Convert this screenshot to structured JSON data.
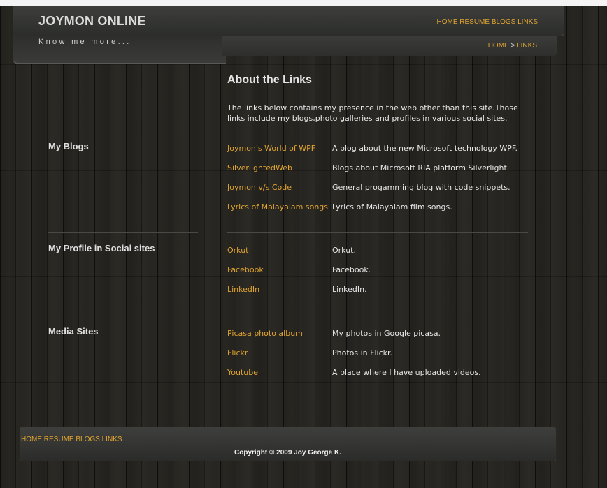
{
  "header": {
    "title": "JOYMON ONLINE",
    "tagline": "Know me more...",
    "nav": [
      "HOME",
      "RESUME",
      "BLOGS",
      "LINKS"
    ],
    "breadcrumb": {
      "home": "HOME",
      "separator": " > ",
      "current": "LINKS"
    }
  },
  "main": {
    "heading": "About the Links",
    "intro": "The links below contains my presence in the web other than this site.Those links include my blogs,photo galleries and profiles in various social sites.",
    "sections": [
      {
        "title": "My Blogs",
        "links": [
          {
            "label": "Joymon's World of WPF",
            "desc": "A blog about the new Microsoft technology WPF."
          },
          {
            "label": "SilverlightedWeb",
            "desc": "Blogs about Microsoft RIA platform Silverlight."
          },
          {
            "label": "Joymon v/s Code",
            "desc": "General progamming blog with code snippets."
          },
          {
            "label": "Lyrics of Malayalam songs",
            "desc": "Lyrics of Malayalam film songs."
          }
        ]
      },
      {
        "title": "My Profile in Social sites",
        "links": [
          {
            "label": "Orkut",
            "desc": "Orkut."
          },
          {
            "label": "Facebook",
            "desc": "Facebook."
          },
          {
            "label": "LinkedIn",
            "desc": "LinkedIn."
          }
        ]
      },
      {
        "title": "Media Sites",
        "links": [
          {
            "label": "Picasa photo album",
            "desc": "My photos in Google picasa."
          },
          {
            "label": "Flickr",
            "desc": "Photos in Flickr."
          },
          {
            "label": "Youtube",
            "desc": "A place where I have uploaded videos."
          }
        ]
      }
    ]
  },
  "footer": {
    "nav": [
      "HOME",
      "RESUME",
      "BLOGS",
      "LINKS"
    ],
    "copyright": "Copyright © 2009 Joy George K."
  },
  "colors": {
    "link": "#e0a431",
    "text": "#e6e6e6",
    "background": "#1e1d19",
    "panel": "#353634"
  }
}
